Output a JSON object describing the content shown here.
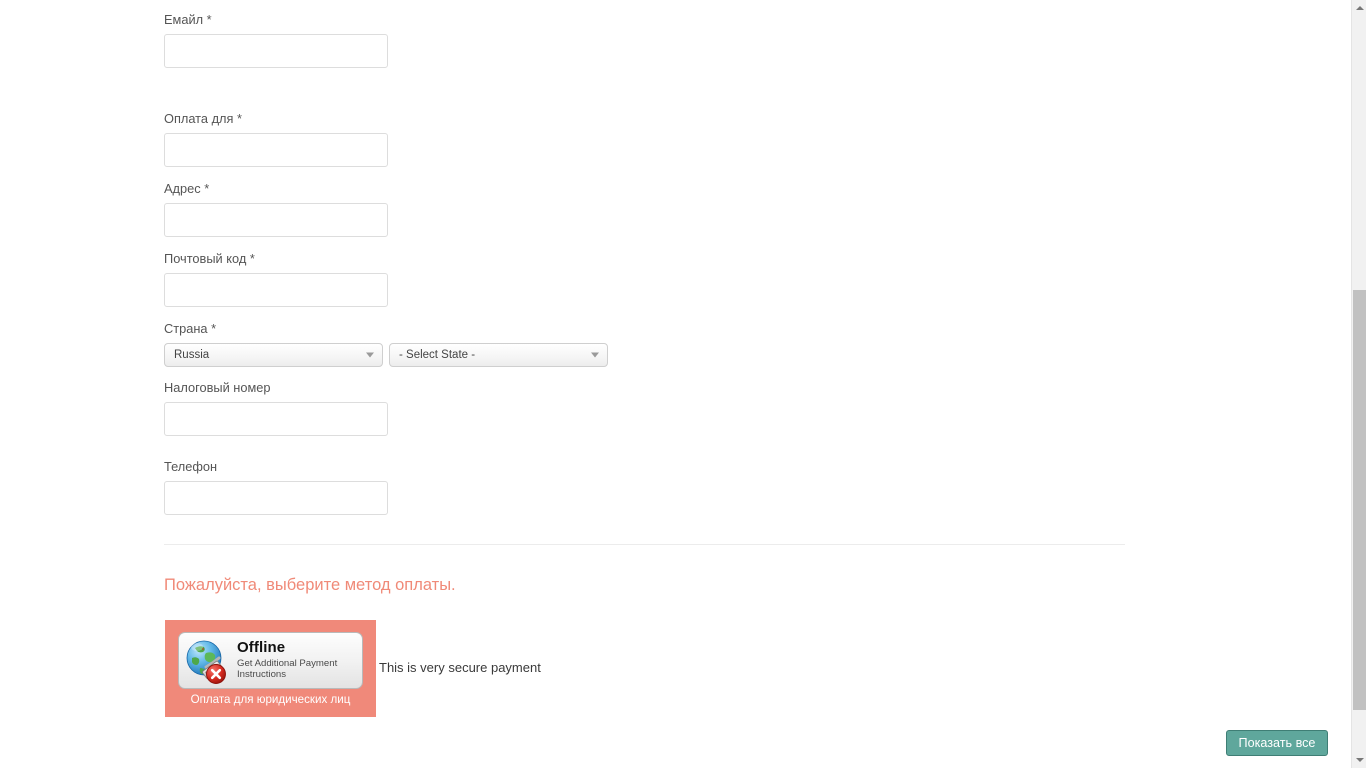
{
  "form": {
    "fields": [
      {
        "label": "Емайл",
        "required": true,
        "value": "",
        "placeholder": "",
        "name": "email"
      },
      {
        "label": "Оплата для",
        "required": true,
        "value": "",
        "placeholder": "",
        "name": "payment-for"
      },
      {
        "label": "Адрес",
        "required": true,
        "value": "",
        "placeholder": "",
        "name": "address"
      },
      {
        "label": "Почтовый код",
        "required": true,
        "value": "",
        "placeholder": "",
        "name": "postal-code"
      },
      {
        "label": "Страна",
        "required": true,
        "value": "",
        "placeholder": "",
        "name": "country"
      },
      {
        "label": "Налоговый номер",
        "required": false,
        "value": "",
        "placeholder": "",
        "name": "tax-number"
      },
      {
        "label": "Телефон",
        "required": false,
        "value": "",
        "placeholder": "",
        "name": "phone"
      }
    ],
    "required_marker": "*",
    "country_select": {
      "selected": "Russia",
      "options": [
        "Russia"
      ]
    },
    "state_select": {
      "selected": "- Select State -",
      "options": [
        "- Select State -"
      ]
    }
  },
  "payment": {
    "error_message": "Пожалуйста, выберите метод оплаты.",
    "method": {
      "title": "Offline",
      "subtitle_line1": "Get Additional Payment",
      "subtitle_line2": "Instructions",
      "caption": "Оплата для юридических лиц",
      "icon": "globe-offline-error-icon"
    },
    "secure_note": "This is very secure payment"
  },
  "actions": {
    "show_all_label": "Показать все"
  },
  "colors": {
    "error_text": "#f08a78",
    "payment_tile_bg": "#f0897a",
    "button_bg": "#5fa79c",
    "button_border": "#3f7e75",
    "input_border": "#dddddd",
    "label_text": "#555555",
    "divider": "#ececec",
    "scrollbar_track": "#f1f1f1",
    "scrollbar_thumb": "#c1c1c1"
  },
  "scrollbar": {
    "up_arrow": "chevron-up-icon",
    "down_arrow": "chevron-down-icon"
  }
}
